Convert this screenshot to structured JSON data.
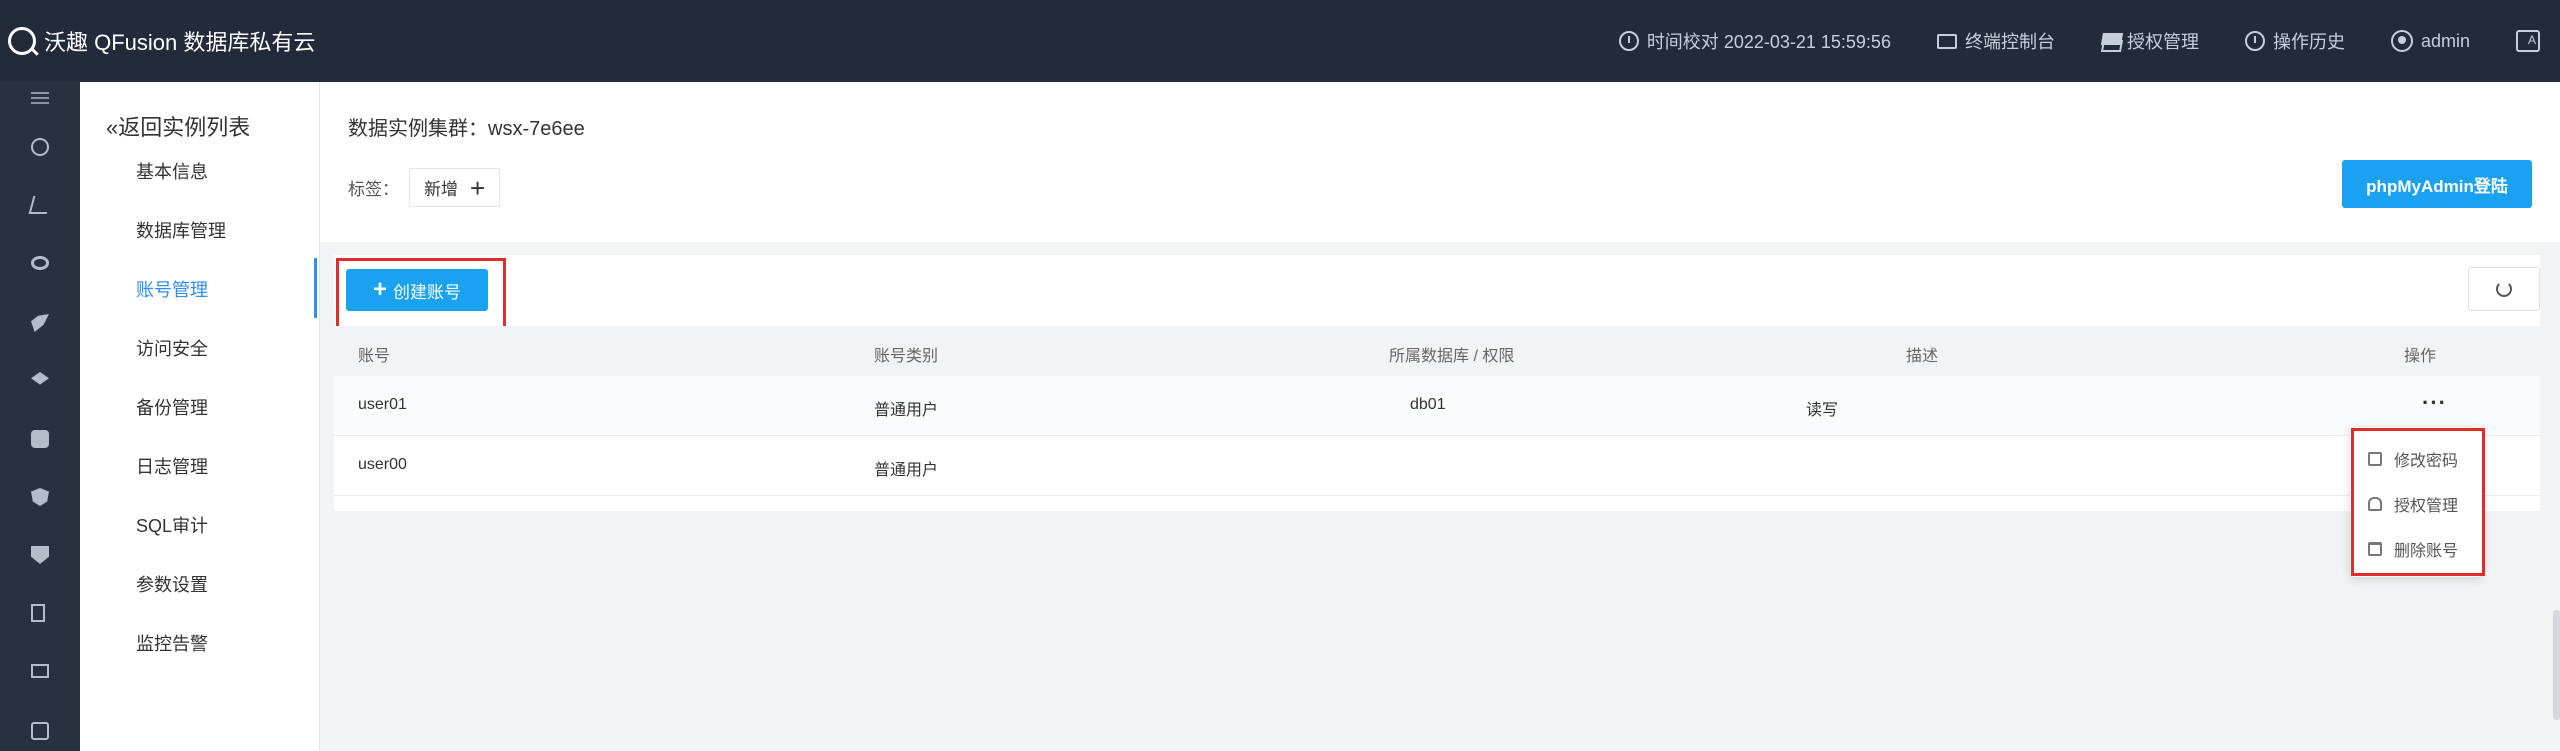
{
  "topbar": {
    "brand": "沃趣 QFusion 数据库私有云",
    "time_label": "时间校对 2022-03-21 15:59:56",
    "console_label": "终端控制台",
    "license_label": "授权管理",
    "history_label": "操作历史",
    "user_label": "admin"
  },
  "subnav": {
    "back_label": "«返回实例列表",
    "items": [
      "基本信息",
      "数据库管理",
      "账号管理",
      "访问安全",
      "备份管理",
      "日志管理",
      "SQL审计",
      "参数设置",
      "监控告警"
    ],
    "active_index": 2
  },
  "header": {
    "cluster_title": "数据实例集群：wsx-7e6ee",
    "tag_label": "标签：",
    "tag_add": "新增",
    "phpmyadmin_button": "phpMyAdmin登陆"
  },
  "toolbar": {
    "create_label": "创建账号"
  },
  "table": {
    "columns": [
      "账号",
      "账号类别",
      "所属数据库 / 权限",
      "描述",
      "操作"
    ],
    "rows": [
      {
        "account": "user01",
        "type": "普通用户",
        "database": "db01",
        "privilege": "读写",
        "description": "",
        "action": "···"
      },
      {
        "account": "user00",
        "type": "普通用户",
        "database": "",
        "privilege": "",
        "description": "",
        "action": ""
      }
    ]
  },
  "dropdown": {
    "items": [
      "修改密码",
      "授权管理",
      "删除账号"
    ]
  },
  "colors": {
    "accent": "#1aa1f0",
    "topbar": "#232a3a",
    "highlight": "#e22b2b"
  }
}
